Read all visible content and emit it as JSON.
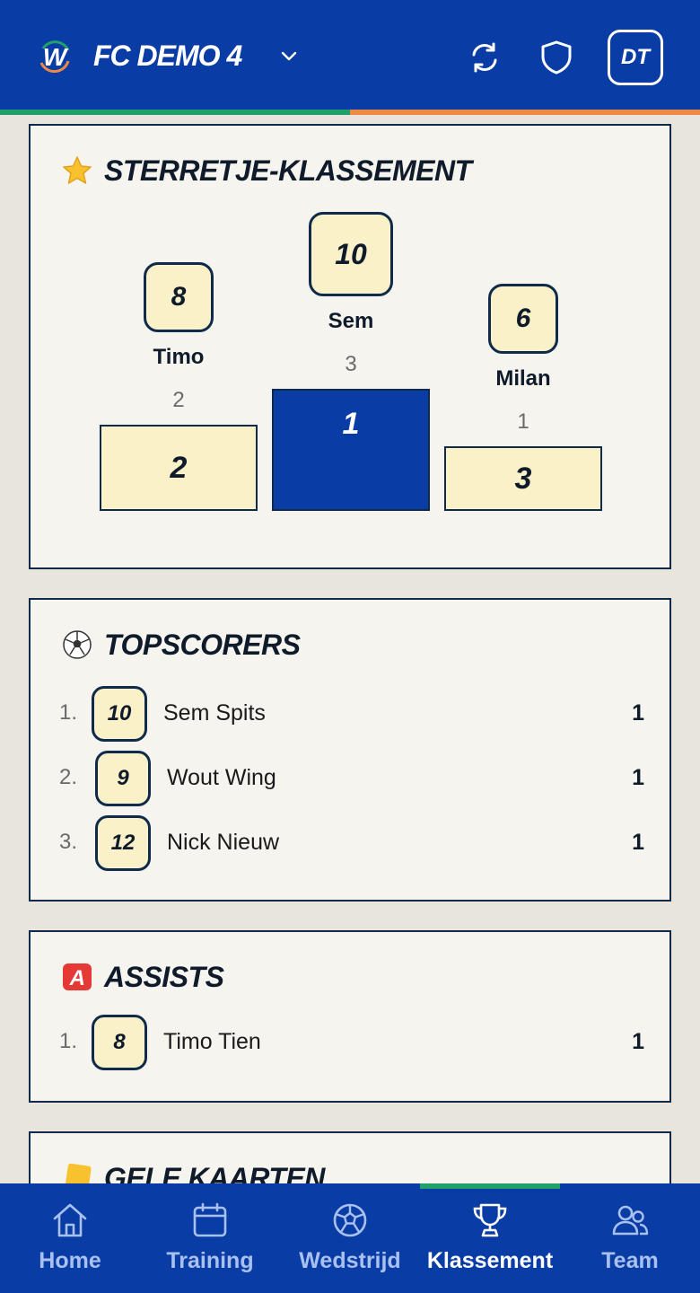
{
  "header": {
    "club_name": "FC DEMO 4",
    "avatar_initials": "DT",
    "colors": {
      "primary": "#0a3ca6",
      "accent_green": "#22a06b",
      "accent_orange": "#ef8a45"
    }
  },
  "star_ranking": {
    "title": "STERRETJE-KLASSEMENT",
    "icon": "star-icon",
    "podium": [
      {
        "place": "2",
        "jersey": "8",
        "name": "Timo",
        "stars": "2"
      },
      {
        "place": "1",
        "jersey": "10",
        "name": "Sem",
        "stars": "3"
      },
      {
        "place": "3",
        "jersey": "6",
        "name": "Milan",
        "stars": "1"
      }
    ]
  },
  "topscorers": {
    "title": "TOPSCORERS",
    "icon": "soccer-ball-icon",
    "rows": [
      {
        "rank": "1.",
        "jersey": "10",
        "name": "Sem Spits",
        "value": "1"
      },
      {
        "rank": "2.",
        "jersey": "9",
        "name": "Wout Wing",
        "value": "1"
      },
      {
        "rank": "3.",
        "jersey": "12",
        "name": "Nick Nieuw",
        "value": "1"
      }
    ]
  },
  "assists": {
    "title": "ASSISTS",
    "icon": "a-button-icon",
    "rows": [
      {
        "rank": "1.",
        "jersey": "8",
        "name": "Timo Tien",
        "value": "1"
      }
    ]
  },
  "yellow_cards": {
    "title": "GELE KAARTEN",
    "icon": "yellow-card-icon"
  },
  "nav": {
    "items": [
      {
        "label": "Home",
        "icon": "home-icon"
      },
      {
        "label": "Training",
        "icon": "calendar-icon"
      },
      {
        "label": "Wedstrijd",
        "icon": "soccer-ball-icon"
      },
      {
        "label": "Klassement",
        "icon": "trophy-icon",
        "active": true
      },
      {
        "label": "Team",
        "icon": "people-icon"
      }
    ]
  }
}
